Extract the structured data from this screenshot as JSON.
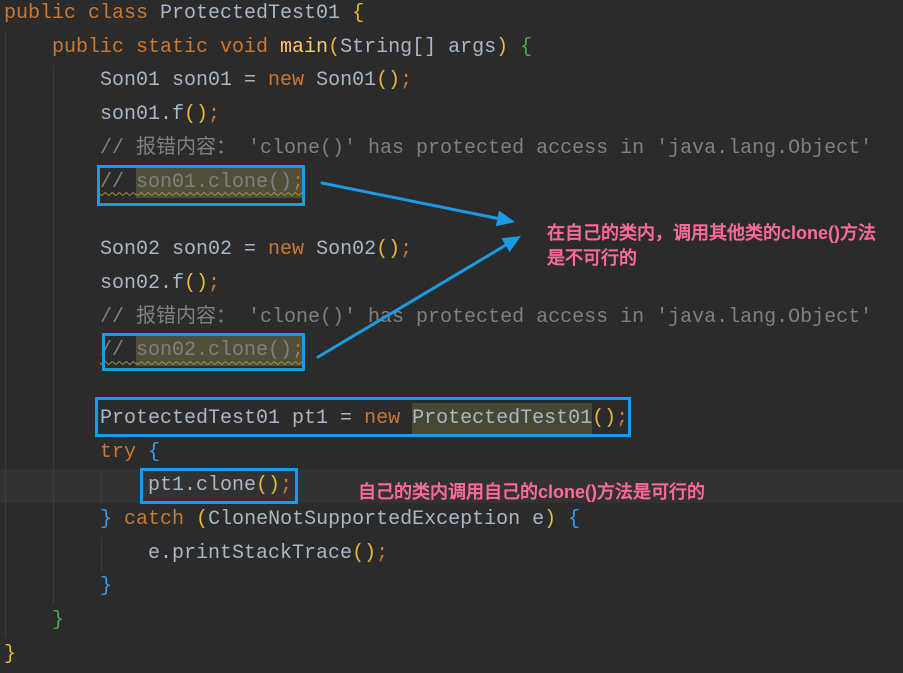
{
  "theme": {
    "background": "#2B2B2B",
    "current_line": "#323232",
    "indent_guide": "#3D3D3D"
  },
  "editor": {
    "lines": [
      {
        "tokens": [
          {
            "text": "public class ",
            "color": "#CC7832"
          },
          {
            "text": "ProtectedTest01 ",
            "color": "#A9B7C6"
          },
          {
            "text": "{",
            "color": "#E8BA36"
          }
        ]
      },
      {
        "tokens": [
          {
            "text": "    public static void ",
            "color": "#CC7832"
          },
          {
            "text": "main",
            "color": "#FFC66D"
          },
          {
            "text": "(",
            "color": "#E8BA36"
          },
          {
            "text": "String[] args",
            "color": "#A9B7C6"
          },
          {
            "text": ")",
            "color": "#E8BA36"
          },
          {
            "text": " {",
            "color": "#54A857"
          }
        ]
      },
      {
        "tokens": [
          {
            "text": "        Son01 son01 = ",
            "color": "#A9B7C6"
          },
          {
            "text": "new ",
            "color": "#CC7832"
          },
          {
            "text": "Son01",
            "color": "#A9B7C6"
          },
          {
            "text": "()",
            "color": "#E8BA36"
          },
          {
            "text": ";",
            "color": "#CC7832"
          }
        ]
      },
      {
        "tokens": [
          {
            "text": "        son01.f",
            "color": "#A9B7C6"
          },
          {
            "text": "()",
            "color": "#E8BA36"
          },
          {
            "text": ";",
            "color": "#CC7832"
          }
        ]
      },
      {
        "tokens": [
          {
            "text": "        // 报错内容： 'clone()' has protected access in 'java.lang.Object'",
            "color": "#808080"
          }
        ]
      },
      {
        "tokens": [
          {
            "text": "        ",
            "color": "#808080"
          },
          {
            "text": "// ",
            "color": "#808080",
            "wavy": "#9C9A4E"
          },
          {
            "text": "son01.clone();",
            "color": "#808080",
            "bg": "#504D38",
            "wavy": "#9C9A4E"
          }
        ]
      },
      {
        "tokens": []
      },
      {
        "tokens": [
          {
            "text": "        Son02 son02 = ",
            "color": "#A9B7C6"
          },
          {
            "text": "new ",
            "color": "#CC7832"
          },
          {
            "text": "Son02",
            "color": "#A9B7C6"
          },
          {
            "text": "()",
            "color": "#E8BA36"
          },
          {
            "text": ";",
            "color": "#CC7832"
          }
        ]
      },
      {
        "tokens": [
          {
            "text": "        son02.f",
            "color": "#A9B7C6"
          },
          {
            "text": "()",
            "color": "#E8BA36"
          },
          {
            "text": ";",
            "color": "#CC7832"
          }
        ]
      },
      {
        "tokens": [
          {
            "text": "        // 报错内容： 'clone()' has protected access in 'java.lang.Object'",
            "color": "#808080"
          }
        ]
      },
      {
        "tokens": [
          {
            "text": "        ",
            "color": "#808080"
          },
          {
            "text": "// ",
            "color": "#808080",
            "wavy": "#9C9A4E"
          },
          {
            "text": "son02.clone();",
            "color": "#808080",
            "bg": "#504D38",
            "wavy": "#9C9A4E"
          }
        ]
      },
      {
        "tokens": []
      },
      {
        "tokens": [
          {
            "text": "        ProtectedTest01 pt1 = ",
            "color": "#A9B7C6"
          },
          {
            "text": "new ",
            "color": "#CC7832"
          },
          {
            "text": "ProtectedTest01",
            "color": "#A9B7C6",
            "bg": "#474834"
          },
          {
            "text": "()",
            "color": "#E8BA36"
          },
          {
            "text": ";",
            "color": "#CC7832"
          }
        ]
      },
      {
        "tokens": [
          {
            "text": "        try",
            "color": "#CC7832"
          },
          {
            "text": " {",
            "color": "#359FF4"
          }
        ]
      },
      {
        "current": true,
        "tokens": [
          {
            "text": "            pt1.clone",
            "color": "#A9B7C6"
          },
          {
            "text": "()",
            "color": "#E8BA36"
          },
          {
            "text": ";",
            "color": "#CC7832"
          }
        ]
      },
      {
        "tokens": [
          {
            "text": "        }",
            "color": "#359FF4"
          },
          {
            "text": " catch ",
            "color": "#CC7832"
          },
          {
            "text": "(",
            "color": "#E8BA36"
          },
          {
            "text": "CloneNotSupportedException e",
            "color": "#A9B7C6"
          },
          {
            "text": ")",
            "color": "#E8BA36"
          },
          {
            "text": " {",
            "color": "#359FF4"
          }
        ]
      },
      {
        "tokens": [
          {
            "text": "            e.printStackTrace",
            "color": "#A9B7C6"
          },
          {
            "text": "()",
            "color": "#E8BA36"
          },
          {
            "text": ";",
            "color": "#CC7832"
          }
        ]
      },
      {
        "tokens": [
          {
            "text": "        }",
            "color": "#359FF4"
          }
        ]
      },
      {
        "tokens": [
          {
            "text": "    }",
            "color": "#54A857"
          }
        ]
      },
      {
        "tokens": [
          {
            "text": "}",
            "color": "#E8BA36"
          }
        ]
      }
    ]
  },
  "annotations": {
    "box_color": "#1A9BE2",
    "note_color": "#FF6A9C",
    "note_other_class": [
      "在自己的类内，调用其他类的clone()方法",
      "是不可行的"
    ],
    "note_own_class": "自己的类内调用自己的clone()方法是可行的"
  }
}
